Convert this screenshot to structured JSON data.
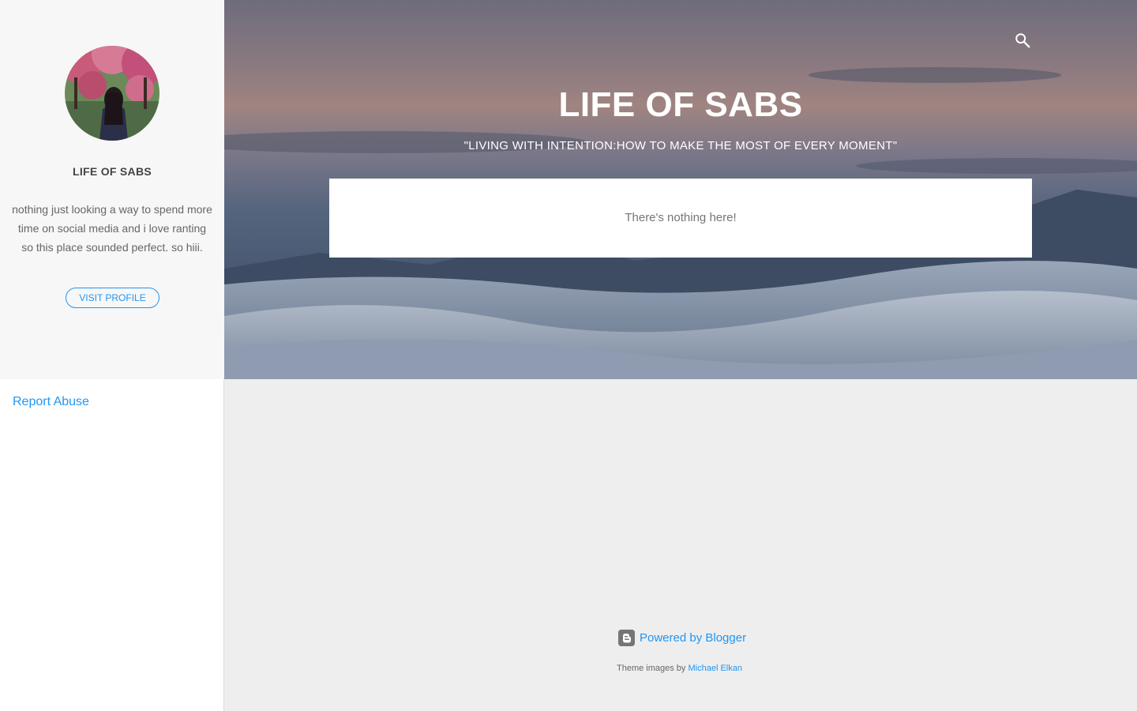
{
  "sidebar": {
    "profile_name": "LIFE OF SABS",
    "bio": "nothing just looking a way to spend more time on social media and i love ranting so this place sounded perfect. so hiii.",
    "visit_profile_label": "VISIT PROFILE",
    "report_abuse_label": "Report Abuse"
  },
  "header": {
    "title": "LIFE OF SABS",
    "description": "\"LIVING WITH INTENTION:HOW TO MAKE THE MOST OF EVERY MOMENT\"",
    "search_icon": "search-icon"
  },
  "main": {
    "empty_message": "There's nothing here!"
  },
  "footer": {
    "powered_by_label": "Powered by Blogger",
    "blogger_icon": "blogger-icon",
    "theme_images_prefix": "Theme images by",
    "theme_images_author": "Michael Elkan"
  },
  "colors": {
    "accent": "#2196f3",
    "sidebar_bg": "#f7f7f7",
    "page_bg": "#eeeeee"
  }
}
